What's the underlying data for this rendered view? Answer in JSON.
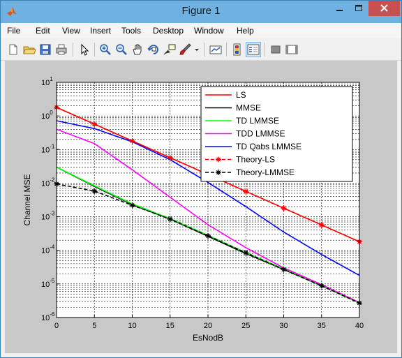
{
  "window": {
    "title": "Figure 1"
  },
  "menu": [
    "File",
    "Edit",
    "View",
    "Insert",
    "Tools",
    "Desktop",
    "Window",
    "Help"
  ],
  "toolbar_icons": [
    "new-figure-icon",
    "open-file-icon",
    "save-icon",
    "print-icon",
    "arrow-cursor-icon",
    "zoom-in-icon",
    "zoom-out-icon",
    "pan-icon",
    "rotate-3d-icon",
    "data-cursor-icon",
    "brush-icon",
    "dropdown-arrow-icon",
    "link-plot-icon",
    "colorbar-icon",
    "legend-icon",
    "hide-plot-tools-icon",
    "show-plot-tools-icon"
  ],
  "chart_data": {
    "type": "line",
    "xlabel": "EsNodB",
    "ylabel": "Channel MSE",
    "xlim": [
      0,
      40
    ],
    "ylim": [
      1e-06,
      10
    ],
    "yscale": "log",
    "grid": true,
    "legend_position": "top-right",
    "x_ticks": [
      0,
      5,
      10,
      15,
      20,
      25,
      30,
      35,
      40
    ],
    "y_tick_exponents": [
      -6,
      -5,
      -4,
      -3,
      -2,
      -1,
      0,
      1
    ],
    "series": [
      {
        "name": "LS",
        "color": "#ff0000",
        "dash": false,
        "marker": false,
        "x": [
          0,
          5,
          10,
          15,
          20,
          25,
          30,
          35,
          40
        ],
        "y": [
          1.8,
          0.57,
          0.18,
          0.057,
          0.018,
          0.0057,
          0.0018,
          0.00057,
          0.00018
        ]
      },
      {
        "name": "MMSE",
        "color": "#000000",
        "dash": false,
        "marker": false,
        "x": [
          0,
          5,
          10,
          15,
          20,
          25,
          30,
          35,
          40
        ],
        "y": [
          0.03,
          0.008,
          0.0023,
          0.00085,
          0.00026,
          8e-05,
          2.7e-05,
          8.8e-06,
          2.7e-06
        ]
      },
      {
        "name": "TD LMMSE",
        "color": "#00ff00",
        "dash": false,
        "marker": false,
        "x": [
          0,
          5,
          10,
          15,
          20,
          25,
          30,
          35,
          40
        ],
        "y": [
          0.03,
          0.0083,
          0.0024,
          0.00088,
          0.00028,
          8.55e-05,
          2.8e-05,
          8.9e-06,
          2.7e-06
        ]
      },
      {
        "name": "TDD LMMSE",
        "color": "#ff00ff",
        "dash": false,
        "marker": false,
        "x": [
          0,
          5,
          10,
          15,
          20,
          25,
          30,
          35,
          40
        ],
        "y": [
          0.4,
          0.15,
          0.025,
          0.0038,
          0.00058,
          0.00012,
          3e-05,
          9.5e-06,
          2.8e-06
        ]
      },
      {
        "name": "TD Qabs LMMSE",
        "color": "#0000ff",
        "dash": false,
        "marker": false,
        "x": [
          0,
          5,
          10,
          15,
          20,
          25,
          30,
          35,
          40
        ],
        "y": [
          0.72,
          0.42,
          0.17,
          0.05,
          0.0105,
          0.002,
          0.00035,
          7.5e-05,
          1.8e-05
        ]
      },
      {
        "name": "Theory-LS",
        "color": "#ff0000",
        "dash": true,
        "marker": true,
        "x": [
          0,
          5,
          10,
          15,
          20,
          25,
          30,
          35,
          40
        ],
        "y": [
          1.8,
          0.57,
          0.18,
          0.057,
          0.018,
          0.0057,
          0.0018,
          0.00057,
          0.00018
        ]
      },
      {
        "name": "Theory-LMMSE",
        "color": "#000000",
        "dash": true,
        "marker": true,
        "x": [
          0,
          5,
          10,
          15,
          20,
          25,
          30,
          35,
          40
        ],
        "y": [
          0.0095,
          0.0058,
          0.0022,
          0.00085,
          0.00027,
          8.5e-05,
          2.7e-05,
          8.8e-06,
          2.7e-06
        ]
      }
    ]
  }
}
